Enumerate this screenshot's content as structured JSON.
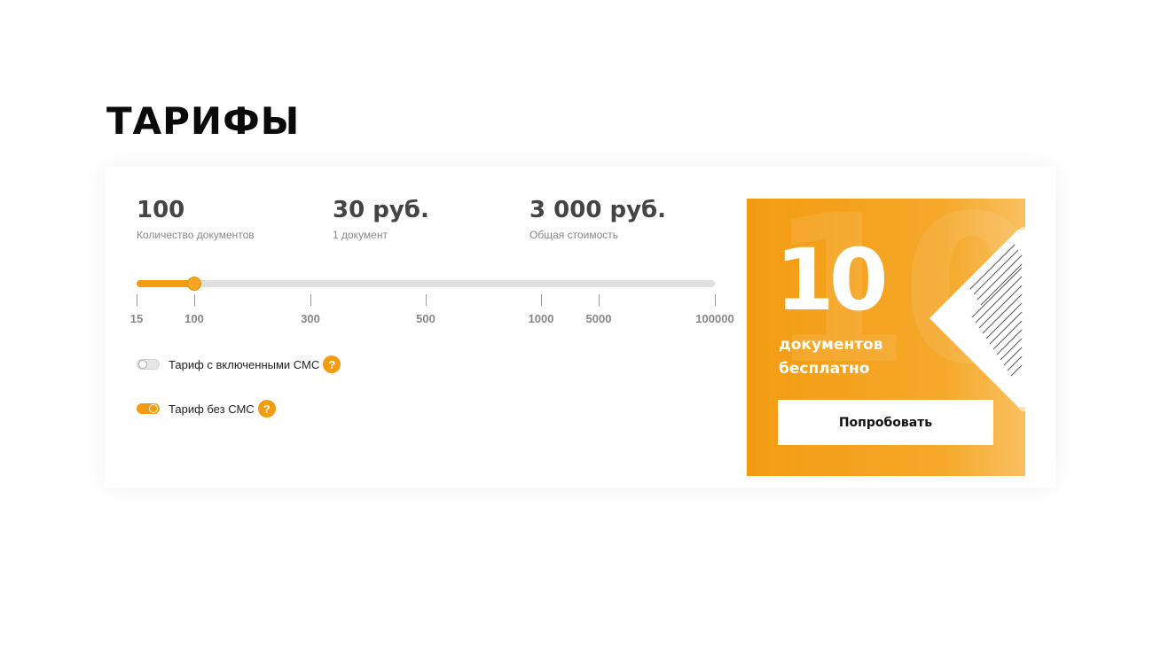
{
  "page": {
    "title": "ТАРИФЫ"
  },
  "stats": {
    "documents": {
      "value": "100",
      "label": "Количество документов"
    },
    "unit_price": {
      "value": "30 руб.",
      "label": "1 документ"
    },
    "total": {
      "value": "3 000 руб.",
      "label": "Общая стоимость"
    }
  },
  "slider": {
    "ticks": [
      "15",
      "100",
      "300",
      "500",
      "1000",
      "5000",
      "100000"
    ],
    "selected_index": 1,
    "fill_color": "#f39c12",
    "track_color": "#e0e0e0"
  },
  "options": {
    "with_sms": {
      "label": "Тариф с включенными СМС",
      "enabled": false,
      "help": "?"
    },
    "without_sms": {
      "label": "Тариф без СМС",
      "enabled": true,
      "help": "?"
    }
  },
  "promo": {
    "number": "10",
    "background_number": "10",
    "line1": "документов",
    "line2": "бесплатно",
    "button_label": "Попробовать",
    "color": "#f39c12"
  }
}
